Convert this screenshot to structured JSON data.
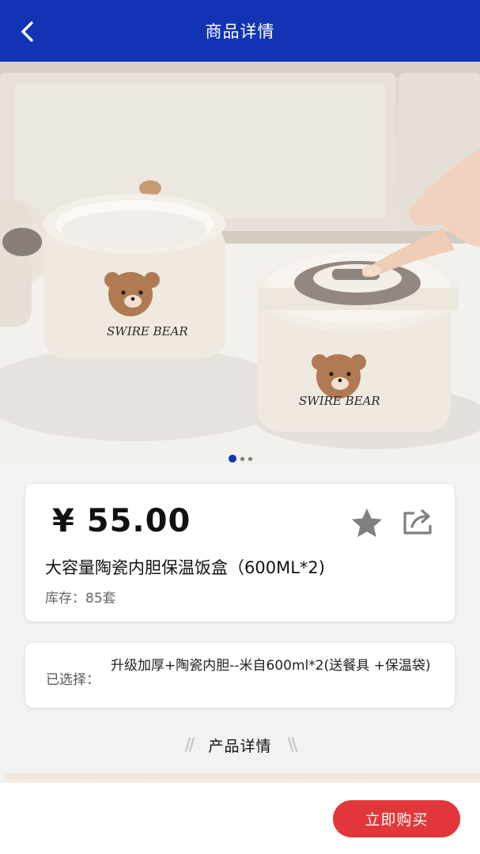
{
  "header": {
    "title": "商品详情",
    "back_icon": "chevron-left-icon",
    "background": "#1234b4"
  },
  "gallery": {
    "slide_count": 3,
    "active_index": 0,
    "image_text": "SWIRE BEAR"
  },
  "product": {
    "price": "¥ 55.00",
    "title": "大容量陶瓷内胆保温饭盒（600ML*2)",
    "stock": "库存：85套",
    "favorite_icon": "star-icon",
    "share_icon": "share-icon"
  },
  "selection": {
    "label": "已选择：",
    "value": "升级加厚+陶瓷内胆--米自600ml*2(送餐具 +保温袋)"
  },
  "details_section": {
    "heading": "产品详情"
  },
  "actions": {
    "buy_now": "立即购买",
    "buy_color": "#e2373a"
  }
}
